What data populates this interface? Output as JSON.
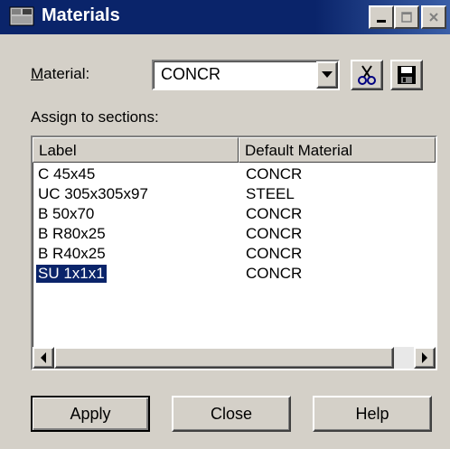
{
  "window": {
    "title": "Materials"
  },
  "material": {
    "label_prefix": "M",
    "label_rest": "aterial:",
    "value": "CONCR"
  },
  "assign_label": "Assign to sections:",
  "table": {
    "columns": [
      "Label",
      "Default Material"
    ],
    "rows": [
      {
        "label": "C 45x45",
        "material": "CONCR"
      },
      {
        "label": "UC 305x305x97",
        "material": "STEEL"
      },
      {
        "label": "B 50x70",
        "material": "CONCR"
      },
      {
        "label": "B R80x25",
        "material": "CONCR"
      },
      {
        "label": "B R40x25",
        "material": "CONCR"
      },
      {
        "label": "SU 1x1x1",
        "material": "CONCR",
        "selected": true
      }
    ]
  },
  "buttons": {
    "apply": "Apply",
    "close": "Close",
    "help": "Help"
  },
  "icons": {
    "cut": "scissors-icon",
    "save": "floppy-disk-icon"
  }
}
